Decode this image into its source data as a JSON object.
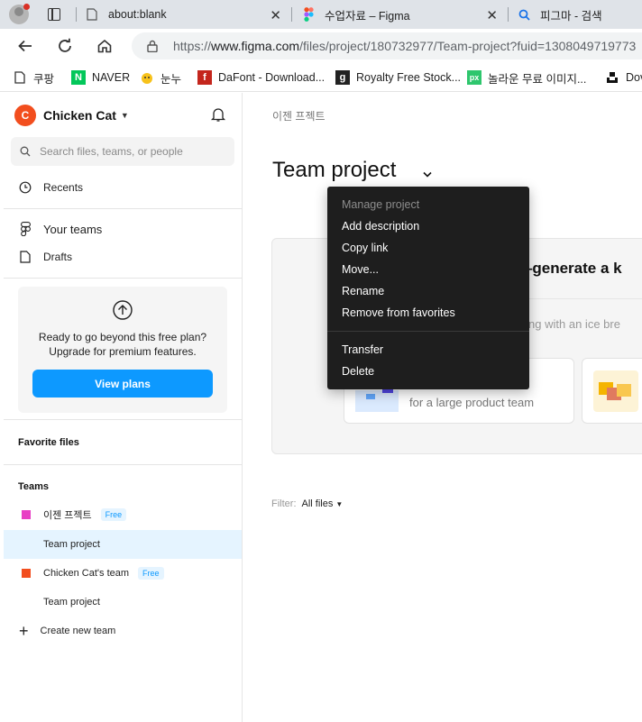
{
  "browser": {
    "tabs": [
      {
        "title": "about:blank",
        "favicon": "page-icon"
      },
      {
        "title": "수업자료 – Figma",
        "favicon": "figma-icon"
      },
      {
        "title": "피그마 - 검색",
        "favicon": "search-icon"
      }
    ],
    "url_prefix": "https://",
    "url_host": "www.figma.com",
    "url_path": "/files/project/180732977/Team-project?fuid=1308049719773",
    "bookmarks": [
      {
        "label": "쿠팡",
        "icon": "bookmark-page-icon"
      },
      {
        "label": "NAVER",
        "icon": "naver-icon"
      },
      {
        "label": "눈누",
        "icon": "noonnu-icon"
      },
      {
        "label": "DaFont - Download...",
        "icon": "dafont-icon"
      },
      {
        "label": "Royalty Free Stock...",
        "icon": "gettyimages-icon"
      },
      {
        "label": "놀라운 무료 이미지...",
        "icon": "pixabay-icon"
      },
      {
        "label": "Dov",
        "icon": "unsplash-icon"
      }
    ]
  },
  "sidebar": {
    "workspace_initial": "C",
    "workspace_name": "Chicken Cat",
    "search_placeholder": "Search files, teams, or people",
    "recents": "Recents",
    "your_teams": "Your teams",
    "drafts": "Drafts",
    "upgrade_text_1": "Ready to go beyond this free plan?",
    "upgrade_text_2": "Upgrade for premium features.",
    "view_plans": "View plans",
    "favorite_files": "Favorite files",
    "teams_title": "Teams",
    "teams": [
      {
        "name": "이젠 프젝트",
        "badge": "Free",
        "color": "#e83ec4"
      },
      {
        "name": "Team project",
        "selected": true
      },
      {
        "name": "Chicken Cat's team",
        "badge": "Free",
        "color": "#f24e1e"
      },
      {
        "name": "Team project"
      }
    ],
    "create_team": "Create new team"
  },
  "main": {
    "breadcrumb": "이젠 프젝트",
    "title": "Team project",
    "banner_title": "n—generate a k",
    "banner_sub": "arting with an ice bre",
    "card_text": "for a large product team",
    "filter_label": "Filter:",
    "filter_value": "All files"
  },
  "menu": {
    "header": "Manage project",
    "items": [
      "Add description",
      "Copy link",
      "Move...",
      "Rename",
      "Remove from favorites"
    ],
    "items2": [
      "Transfer",
      "Delete"
    ]
  },
  "colors": {
    "accent": "#0d99ff",
    "menu_bg": "#1e1e1e",
    "workspace_avatar": "#f24e1e"
  }
}
